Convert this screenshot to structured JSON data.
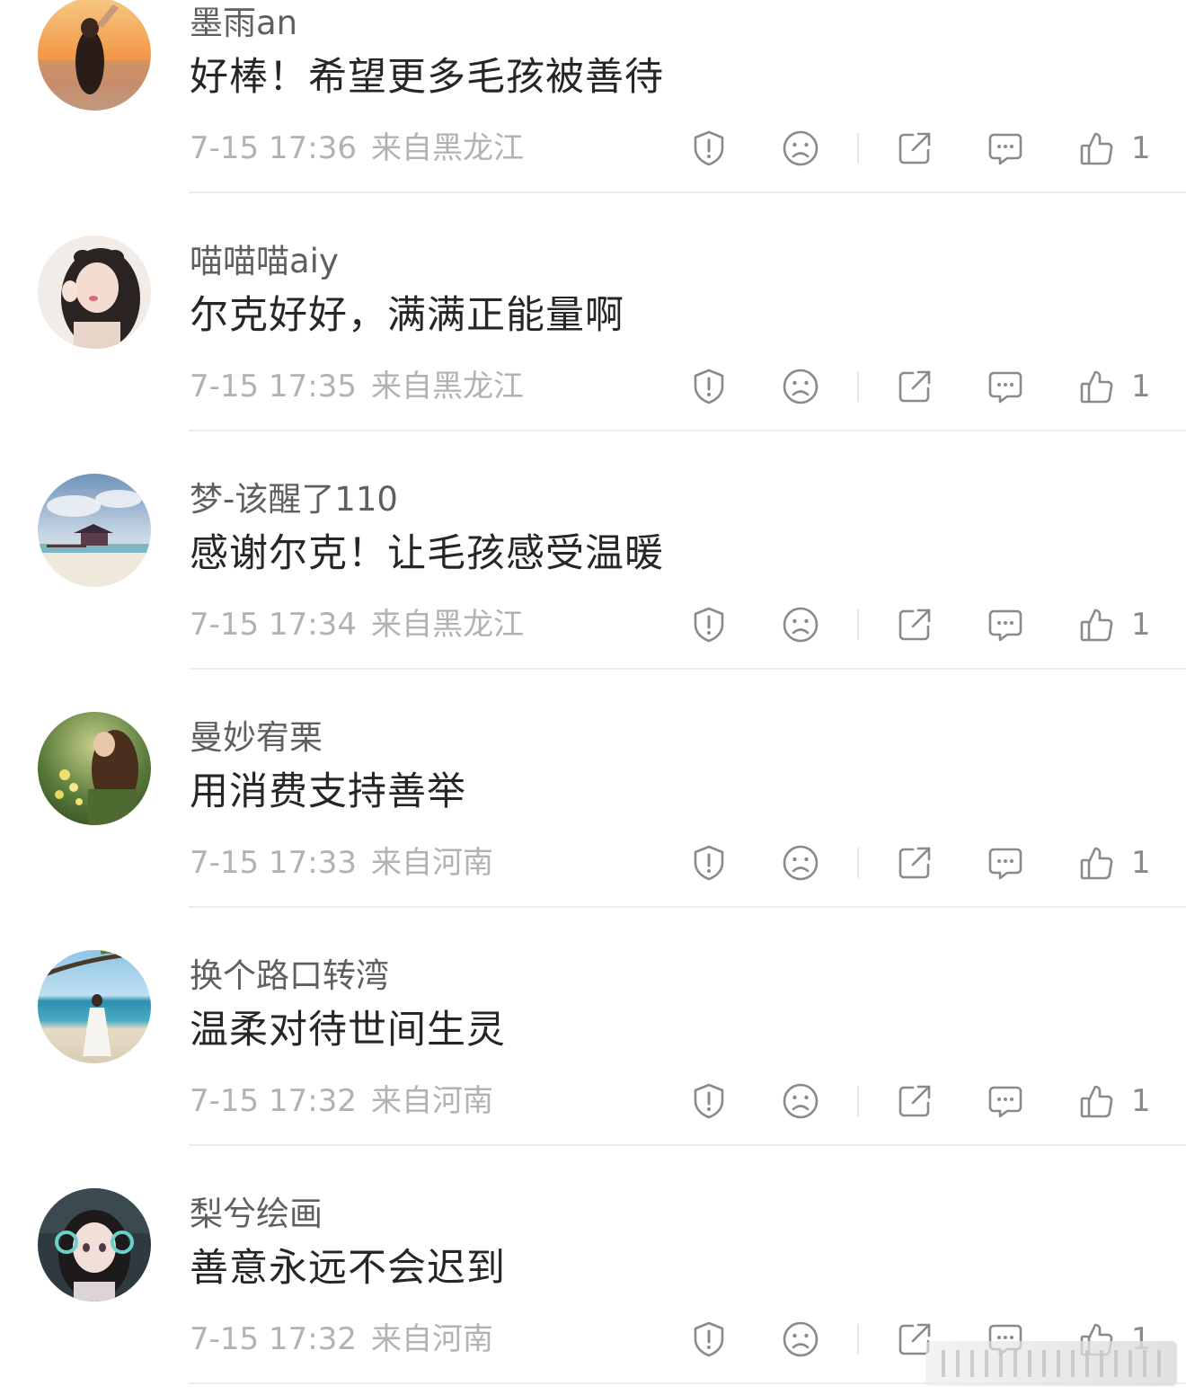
{
  "comments": [
    {
      "username": "墨雨an",
      "content": "好棒！希望更多毛孩被善待",
      "time": "7-15 17:36",
      "location": "来自黑龙江",
      "likes": "1"
    },
    {
      "username": "喵喵喵aiy",
      "content": "尔克好好，满满正能量啊",
      "time": "7-15 17:35",
      "location": "来自黑龙江",
      "likes": "1"
    },
    {
      "username": "梦-该醒了110",
      "content": "感谢尔克！让毛孩感受温暖",
      "time": "7-15 17:34",
      "location": "来自黑龙江",
      "likes": "1"
    },
    {
      "username": "曼妙宥栗",
      "content": "用消费支持善举",
      "time": "7-15 17:33",
      "location": "来自河南",
      "likes": "1"
    },
    {
      "username": "换个路口转湾",
      "content": "温柔对待世间生灵",
      "time": "7-15 17:32",
      "location": "来自河南",
      "likes": "1"
    },
    {
      "username": "梨兮绘画",
      "content": "善意永远不会迟到",
      "time": "7-15 17:32",
      "location": "来自河南",
      "likes": "1"
    }
  ],
  "icons": {
    "report": "report-shield-icon",
    "dislike": "frown-face-icon",
    "share": "share-external-icon",
    "reply": "comment-bubble-icon",
    "like": "thumbs-up-icon"
  },
  "colors": {
    "username": "#5f5f5f",
    "content": "#262626",
    "meta": "#b2b2b2",
    "icon": "#8a8a8a",
    "divider": "#ececec"
  }
}
